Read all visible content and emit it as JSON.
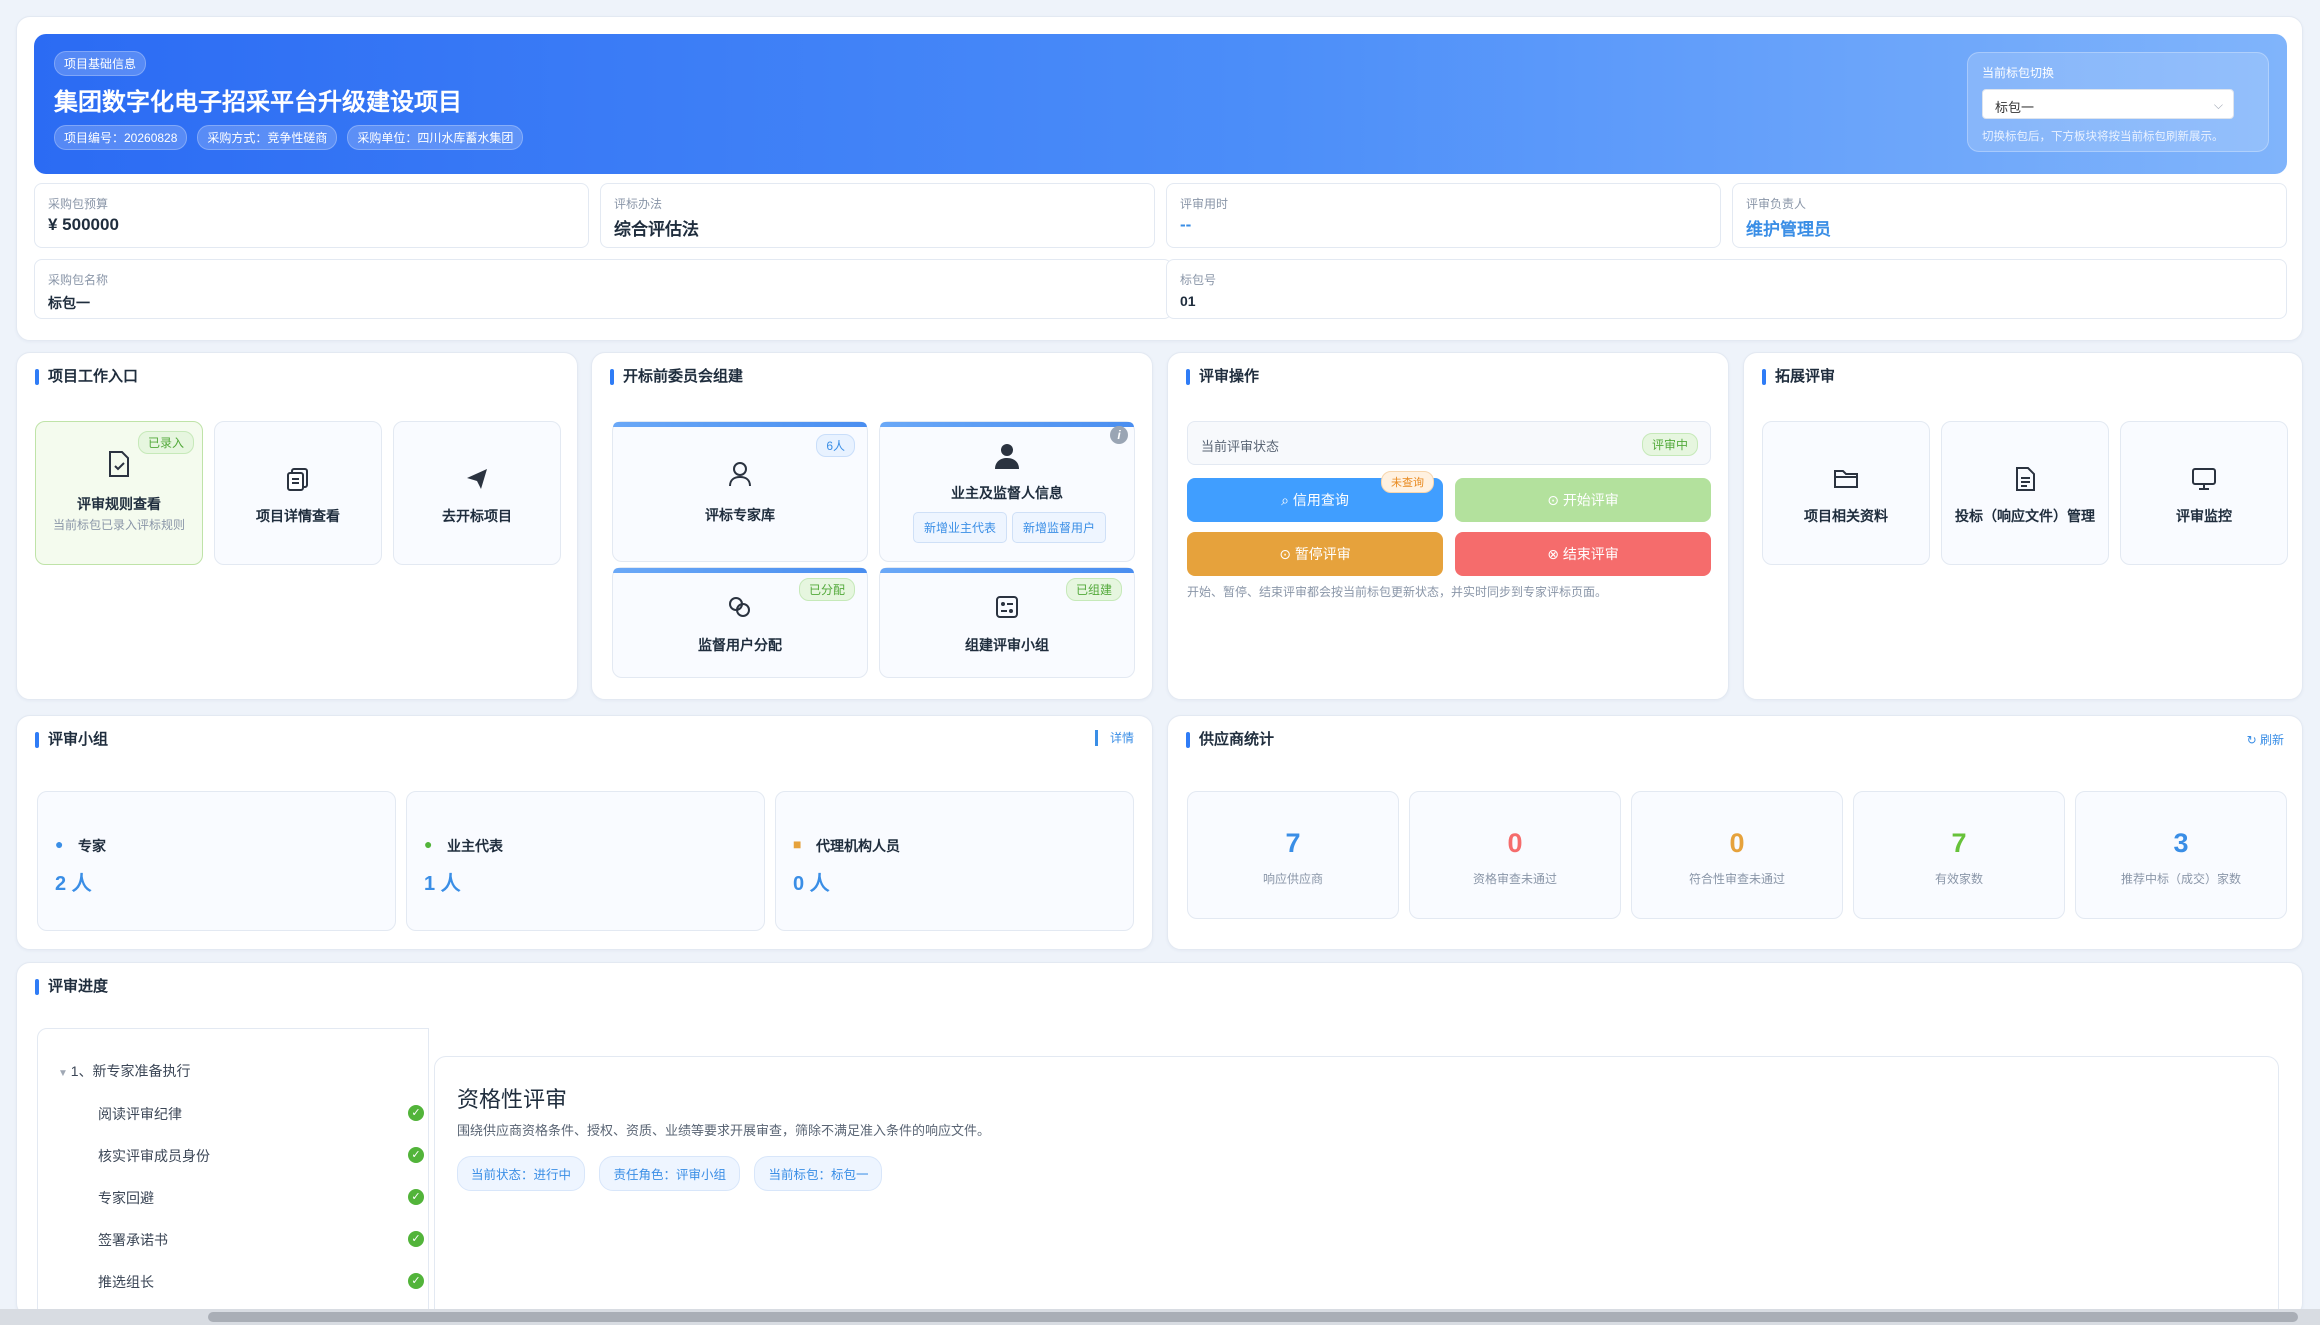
{
  "banner": {
    "tag": "项目基础信息",
    "title": "集团数字化电子招采平台升级建设项目",
    "chips": [
      "项目编号：20260828",
      "采购方式：竞争性磋商",
      "采购单位：四川水库蓄水集团"
    ],
    "switch_label": "当前标包切换",
    "switch_value": "标包一",
    "switch_hint": "切换标包后，下方板块将按当前标包刷新展示。"
  },
  "info": {
    "budget": {
      "label": "采购包预算",
      "value": "¥ 500000"
    },
    "method": {
      "label": "评标办法",
      "value": "综合评估法"
    },
    "time": {
      "label": "评审用时",
      "value": "--"
    },
    "leader": {
      "label": "评审负责人",
      "value": "维护管理员"
    },
    "package_name": {
      "label": "采购包名称",
      "value": "标包一"
    },
    "package_no": {
      "label": "标包号",
      "value": "01"
    }
  },
  "work_entry": {
    "title": "项目工作入口",
    "cards": [
      {
        "label": "评审规则查看",
        "sub": "当前标包已录入评标规则",
        "badge": "已录入",
        "icon": "document-check-icon"
      },
      {
        "label": "项目详情查看",
        "icon": "copy-document-icon"
      },
      {
        "label": "去开标项目",
        "icon": "paper-plane-icon"
      }
    ]
  },
  "committee": {
    "title": "开标前委员会组建",
    "expert_lib": {
      "label": "评标专家库",
      "badge": "6人"
    },
    "owner_info": {
      "label": "业主及监督人信息",
      "btn1": "新增业主代表",
      "btn2": "新增监督用户"
    },
    "supervisor": {
      "label": "监督用户分配",
      "badge": "已分配"
    },
    "group": {
      "label": "组建评审小组",
      "badge": "已组建"
    }
  },
  "operations": {
    "title": "评审操作",
    "status_label": "当前评审状态",
    "status_value": "评审中",
    "credit": "信用查询",
    "credit_badge": "未查询",
    "start": "开始评审",
    "pause": "暂停评审",
    "end": "结束评审",
    "hint": "开始、暂停、结束评审都会按当前标包更新状态，并实时同步到专家评标页面。",
    "colors": {
      "credit": "#409eff",
      "start": "#b3e19d",
      "pause": "#e6a23c",
      "end": "#f56c6c"
    }
  },
  "extend": {
    "title": "拓展评审",
    "cards": [
      {
        "label": "项目相关资料",
        "icon": "folder-icon"
      },
      {
        "label": "投标（响应文件）管理",
        "icon": "file-text-icon"
      },
      {
        "label": "评审监控",
        "icon": "monitor-icon"
      }
    ]
  },
  "review_group": {
    "title": "评审小组",
    "detail": "详情",
    "items": [
      {
        "label": "专家",
        "value": "2 人"
      },
      {
        "label": "业主代表",
        "value": "1 人"
      },
      {
        "label": "代理机构人员",
        "value": "0 人"
      }
    ]
  },
  "supplier_stats": {
    "title": "供应商统计",
    "refresh": "刷新",
    "items": [
      {
        "value": "7",
        "label": "响应供应商",
        "color": "#3a8ee6"
      },
      {
        "value": "0",
        "label": "资格审查未通过",
        "color": "#f56c6c"
      },
      {
        "value": "0",
        "label": "符合性审查未通过",
        "color": "#e6a23c"
      },
      {
        "value": "7",
        "label": "有效家数",
        "color": "#67c23a"
      },
      {
        "value": "3",
        "label": "推荐中标（成交）家数",
        "color": "#3a8ee6"
      }
    ]
  },
  "progress": {
    "title": "评审进度",
    "group": "1、新专家准备执行",
    "steps": [
      "阅读评审纪律",
      "核实评审成员身份",
      "专家回避",
      "签署承诺书",
      "推选组长"
    ],
    "stage_title": "资格性评审",
    "stage_desc": "围绕供应商资格条件、授权、资质、业绩等要求开展审查，筛除不满足准入条件的响应文件。",
    "pills": [
      "当前状态：进行中",
      "责任角色：评审小组",
      "当前标包：标包一"
    ]
  }
}
